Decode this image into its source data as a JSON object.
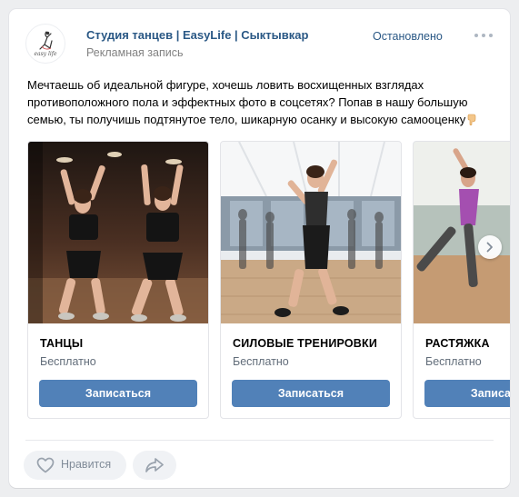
{
  "post": {
    "author_name": "Студия танцев | EasyLife | Сыктывкар",
    "avatar_caption": "easy life",
    "ad_label": "Рекламная запись",
    "status_label": "Остановлено",
    "text": "Мечтаешь об идеальной фигуре, хочешь ловить восхищенных взглядах противоположного пола и эффектных фото в соцсетях? Попав в нашу большую семью, ты получишь подтянутое тело, шикарную осанку и высокую самооценку"
  },
  "carousel": {
    "cards": [
      {
        "title": "ТАНЦЫ",
        "price": "Бесплатно",
        "button": "Записаться"
      },
      {
        "title": "СИЛОВЫЕ ТРЕНИРОВКИ",
        "price": "Бесплатно",
        "button": "Записаться"
      },
      {
        "title": "РАСТЯЖКА",
        "price": "Бесплатно",
        "button": "Записаться"
      }
    ]
  },
  "actions": {
    "like_label": "Нравится"
  },
  "colors": {
    "link": "#2a5885",
    "button": "#5181b8",
    "muted": "#828282",
    "page_bg": "#edeef0"
  },
  "icons": {
    "more": "more-horizontal-icon",
    "like": "heart-outline-icon",
    "share": "share-arrow-icon",
    "next": "chevron-right-icon",
    "emoji": "pointing-down-hand-emoji"
  }
}
